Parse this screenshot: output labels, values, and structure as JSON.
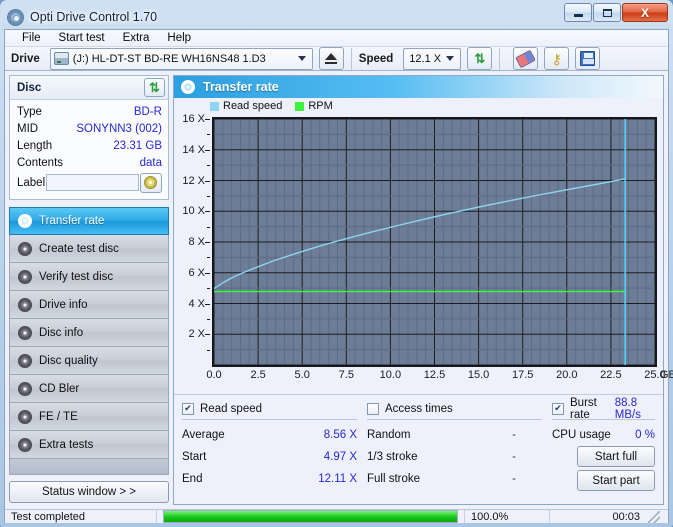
{
  "window": {
    "title": "Opti Drive Control 1.70",
    "icon": "disc-icon",
    "buttons": {
      "minimize": "–",
      "maximize": "□",
      "close": "X"
    }
  },
  "menu": {
    "items": [
      "File",
      "Start test",
      "Extra",
      "Help"
    ]
  },
  "toolbar": {
    "drive_label": "Drive",
    "drive_value": "(J:)  HL-DT-ST BD-RE  WH16NS48 1.D3",
    "eject_icon": "eject-icon",
    "speed_label": "Speed",
    "speed_value": "12.1 X",
    "refresh_icon": "refresh-icon",
    "eraser_icon": "eraser-icon",
    "keys_icon": "keys-icon",
    "save_icon": "save-icon"
  },
  "disc": {
    "header": "Disc",
    "refresh_icon": "refresh-icon",
    "rows": [
      {
        "key": "Type",
        "value": "BD-R"
      },
      {
        "key": "MID",
        "value": "SONYNN3 (002)"
      },
      {
        "key": "Length",
        "value": "23.31 GB"
      },
      {
        "key": "Contents",
        "value": "data"
      }
    ],
    "label_key": "Label",
    "label_value": "",
    "label_placeholder": "",
    "disc_button_icon": "cd-icon"
  },
  "nav": {
    "items": [
      {
        "label": "Transfer rate",
        "icon": "disc-icon",
        "active": true
      },
      {
        "label": "Create test disc",
        "icon": "disc-icon",
        "active": false
      },
      {
        "label": "Verify test disc",
        "icon": "disc-icon",
        "active": false
      },
      {
        "label": "Drive info",
        "icon": "disc-icon",
        "active": false
      },
      {
        "label": "Disc info",
        "icon": "disc-icon",
        "active": false
      },
      {
        "label": "Disc quality",
        "icon": "disc-icon",
        "active": false
      },
      {
        "label": "CD Bler",
        "icon": "disc-icon",
        "active": false
      },
      {
        "label": "FE / TE",
        "icon": "disc-icon",
        "active": false
      },
      {
        "label": "Extra tests",
        "icon": "disc-icon",
        "active": false
      }
    ],
    "status_window_label": "Status window > >"
  },
  "panel": {
    "title": "Transfer rate",
    "icon": "disc-icon"
  },
  "chart_data": {
    "type": "line",
    "title": "Transfer rate",
    "xlabel": "GB",
    "ylabel": "X",
    "xlim": [
      0.0,
      25.0
    ],
    "ylim": [
      0,
      16
    ],
    "xticks": [
      "0.0",
      "2.5",
      "5.0",
      "7.5",
      "10.0",
      "12.5",
      "15.0",
      "17.5",
      "20.0",
      "22.5",
      "25.0"
    ],
    "xtick_values": [
      0.0,
      2.5,
      5.0,
      7.5,
      10.0,
      12.5,
      15.0,
      17.5,
      20.0,
      22.5,
      25.0
    ],
    "x_unit": "GB",
    "yticks": [
      "2 X",
      "4 X",
      "6 X",
      "8 X",
      "10 X",
      "12 X",
      "14 X",
      "16 X"
    ],
    "ytick_values": [
      2,
      4,
      6,
      8,
      10,
      12,
      14,
      16
    ],
    "grid": true,
    "plot_bg": "#6d7d96",
    "legend_position": "top-left",
    "marker_x": 23.31,
    "marker_color": "#4fd2f7",
    "series": [
      {
        "name": "Read speed",
        "color": "#8fd4f2",
        "x": [
          0.0,
          0.6,
          1.2,
          1.9,
          2.6,
          3.4,
          4.3,
          5.3,
          6.4,
          7.6,
          8.9,
          10.3,
          11.8,
          13.4,
          15.0,
          16.7,
          18.4,
          20.1,
          21.8,
          23.31
        ],
        "values": [
          4.97,
          5.42,
          5.78,
          6.12,
          6.44,
          6.79,
          7.13,
          7.49,
          7.87,
          8.25,
          8.64,
          9.04,
          9.45,
          9.87,
          10.27,
          10.67,
          11.06,
          11.42,
          11.78,
          12.11
        ]
      },
      {
        "name": "RPM",
        "color": "#3ef23e",
        "x": [
          0.0,
          23.31
        ],
        "values": [
          4.78,
          4.78
        ]
      }
    ]
  },
  "results": {
    "read_speed": {
      "checked": true,
      "label": "Read speed",
      "rows": [
        {
          "key": "Average",
          "value": "8.56 X"
        },
        {
          "key": "Start",
          "value": "4.97 X"
        },
        {
          "key": "End",
          "value": "12.11 X"
        }
      ]
    },
    "access_times": {
      "checked": false,
      "label": "Access times",
      "rows": [
        {
          "key": "Random",
          "value": "-"
        },
        {
          "key": "1/3 stroke",
          "value": "-"
        },
        {
          "key": "Full stroke",
          "value": "-"
        }
      ]
    },
    "burst": {
      "checked": true,
      "label": "Burst rate",
      "value": "88.8 MB/s",
      "cpu_label": "CPU usage",
      "cpu_value": "0 %",
      "start_full": "Start full",
      "start_part": "Start part"
    }
  },
  "statusbar": {
    "status": "Test completed",
    "progress_percent": 100.0,
    "progress_text": "100.0%",
    "elapsed": "00:03"
  }
}
